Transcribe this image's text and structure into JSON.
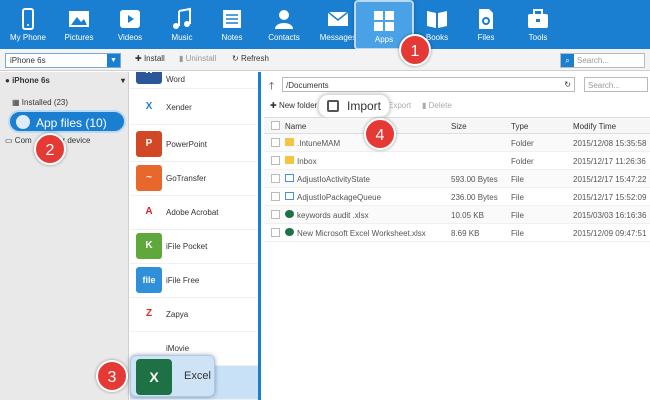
{
  "nav": [
    {
      "label": "My Phone",
      "icon": "phone-icon"
    },
    {
      "label": "Pictures",
      "icon": "picture-icon"
    },
    {
      "label": "Videos",
      "icon": "video-icon"
    },
    {
      "label": "Music",
      "icon": "music-icon"
    },
    {
      "label": "Notes",
      "icon": "notes-icon"
    },
    {
      "label": "Contacts",
      "icon": "contacts-icon"
    },
    {
      "label": "Messages",
      "icon": "messages-icon"
    },
    {
      "label": "Apps",
      "icon": "apps-icon"
    },
    {
      "label": "Books",
      "icon": "books-icon"
    },
    {
      "label": "Files",
      "icon": "files-icon"
    },
    {
      "label": "Tools",
      "icon": "tools-icon"
    }
  ],
  "toolbar": {
    "device": "iPhone 6s",
    "install": "Install",
    "uninstall": "Uninstall",
    "refresh": "Refresh",
    "search_placeholder": "Search..."
  },
  "sidebar": {
    "device_name": "iPhone 6s",
    "installed": "Installed (23)",
    "app_files": "App files (10)",
    "computer_device": "Computer device",
    "computer_prefix": "Com"
  },
  "apps": [
    {
      "name": "Word",
      "color": "#2b579a",
      "glyph": "W"
    },
    {
      "name": "Xender",
      "color": "#ffffff",
      "glyph": "X"
    },
    {
      "name": "PowerPoint",
      "color": "#d24726",
      "glyph": "P"
    },
    {
      "name": "GoTransfer",
      "color": "#e8672c",
      "glyph": "~"
    },
    {
      "name": "Adobe Acrobat",
      "color": "#ffffff",
      "glyph": "A"
    },
    {
      "name": "iFile Pocket",
      "color": "#5fa83b",
      "glyph": "K"
    },
    {
      "name": "iFile Free",
      "color": "#2f8fd8",
      "glyph": "file"
    },
    {
      "name": "Zapya",
      "color": "#ffffff",
      "glyph": "Z"
    },
    {
      "name": "iMovie",
      "color": "#ffffff",
      "glyph": ""
    },
    {
      "name": "",
      "color": "#c9e1f7",
      "glyph": ""
    }
  ],
  "pane": {
    "path": "/Documents",
    "search_placeholder": "Search...",
    "new_folder": "New folder",
    "import": "Import",
    "export": "Export",
    "delete": "Delete"
  },
  "table": {
    "headers": {
      "name": "Name",
      "size": "Size",
      "type": "Type",
      "time": "Modify Time"
    },
    "rows": [
      {
        "name": ".IntuneMAM",
        "size": "",
        "type": "Folder",
        "time": "2015/12/08 15:35:58",
        "kind": "folder"
      },
      {
        "name": "Inbox",
        "size": "",
        "type": "Folder",
        "time": "2015/12/17 11:26:36",
        "kind": "folder"
      },
      {
        "name": "AdjustIoActivityState",
        "size": "593.00 Bytes",
        "type": "File",
        "time": "2015/12/17 15:47:22",
        "kind": "file"
      },
      {
        "name": "AdjustIoPackageQueue",
        "size": "236.00 Bytes",
        "type": "File",
        "time": "2015/12/17 15:52:09",
        "kind": "file"
      },
      {
        "name": "keywords audit .xlsx",
        "size": "10.05 KB",
        "type": "File",
        "time": "2015/03/03 16:16:36",
        "kind": "xlsx"
      },
      {
        "name": "New Microsoft Excel Worksheet.xlsx",
        "size": "8.69 KB",
        "type": "File",
        "time": "2015/12/09 09:47:51",
        "kind": "xlsx"
      }
    ]
  },
  "callouts": {
    "c1": "1",
    "c2": "2",
    "c3": "3",
    "c4": "4"
  },
  "excel_popup": {
    "name": "Excel",
    "glyph": "X"
  },
  "colors": {
    "brand": "#1b7fd1",
    "callout": "#e53935",
    "excel": "#1e7145"
  }
}
